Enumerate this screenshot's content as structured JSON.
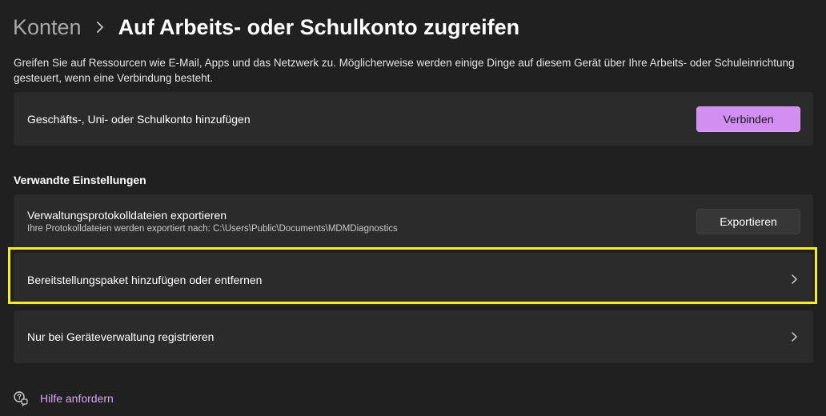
{
  "header": {
    "breadcrumb_parent": "Konten",
    "title": "Auf Arbeits- oder Schulkonto zugreifen"
  },
  "intro": "Greifen Sie auf Ressourcen wie E-Mail, Apps und das Netzwerk zu. Möglicherweise werden einige Dinge auf diesem Gerät über Ihre Arbeits- oder Schuleinrichtung gesteuert, wenn eine Verbindung besteht.",
  "add_account": {
    "label": "Geschäfts-, Uni- oder Schulkonto hinzufügen",
    "button": "Verbinden"
  },
  "related": {
    "heading": "Verwandte Einstellungen",
    "export": {
      "title": "Verwaltungsprotokolldateien exportieren",
      "subtitle": "Ihre Protokolldateien werden exportiert nach: C:\\Users\\Public\\Documents\\MDMDiagnostics",
      "button": "Exportieren"
    },
    "provisioning": {
      "title": "Bereitstellungspaket hinzufügen oder entfernen"
    },
    "enroll": {
      "title": "Nur bei Geräteverwaltung registrieren"
    }
  },
  "help": {
    "label": "Hilfe anfordern",
    "icon": "help-chat-icon"
  },
  "colors": {
    "background": "#202020",
    "card": "#2b2b2b",
    "accent": "#d28ef0",
    "highlight": "#f5ea2b",
    "link": "#d8a4f0"
  }
}
